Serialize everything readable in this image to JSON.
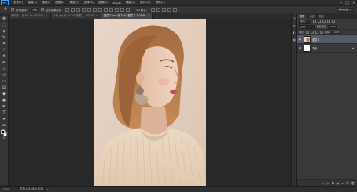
{
  "app": {
    "logo": "Ps",
    "menu": [
      "文件(F)",
      "编辑(E)",
      "图像(I)",
      "图层(L)",
      "类型(Y)",
      "选择(S)",
      "滤镜(T)",
      "3D(D)",
      "视图(V)",
      "窗口(W)",
      "帮助(H)"
    ],
    "window_controls": [
      "–",
      "□",
      "✕"
    ]
  },
  "options_bar": {
    "tool_icon": "move-tool-icon",
    "auto_select_label": "自动选择:",
    "auto_select_value": "组",
    "transform_controls_label": "显示变换控件",
    "mode_3d_label": "3D 模式:",
    "workspace": "基本功能"
  },
  "tabs": [
    {
      "label": "未标题-1 @ 66.7% (RGB/8)",
      "active": false
    },
    {
      "label": "人像.jpg @ 33.3% (图层 1, RGB/8)",
      "active": false
    },
    {
      "label": "图层 1.psd @ 25% (图层 1, RGB/8)",
      "active": true
    }
  ],
  "toolbox": {
    "tools": [
      "move-tool-icon",
      "marquee-tool-icon",
      "lasso-tool-icon",
      "quick-select-icon",
      "crop-tool-icon",
      "eyedropper-icon",
      "healing-brush-icon",
      "brush-tool-icon",
      "clone-stamp-icon",
      "history-brush-icon",
      "eraser-icon",
      "gradient-icon",
      "blur-icon",
      "dodge-icon",
      "pen-tool-icon",
      "type-tool-icon",
      "path-select-icon",
      "shape-tool-icon",
      "hand-tool-icon",
      "zoom-tool-icon"
    ],
    "foreground_color": "#000000",
    "background_color": "#ffffff"
  },
  "status": {
    "zoom": "25%",
    "doc_info": "文档:1.44M/3.81M"
  },
  "layers_panel": {
    "tabs": [
      "图层",
      "通道",
      "路径"
    ],
    "filter_label": "类型",
    "blend_mode": "正常",
    "opacity_label": "不透明度:",
    "opacity_value": "100%",
    "lock_label": "锁定:",
    "fill_label": "填充:",
    "fill_value": "100%",
    "layers": [
      {
        "name": "图层 1",
        "selected": true,
        "visible": true
      },
      {
        "name": "背景",
        "selected": false,
        "visible": true,
        "locked": true
      }
    ]
  }
}
